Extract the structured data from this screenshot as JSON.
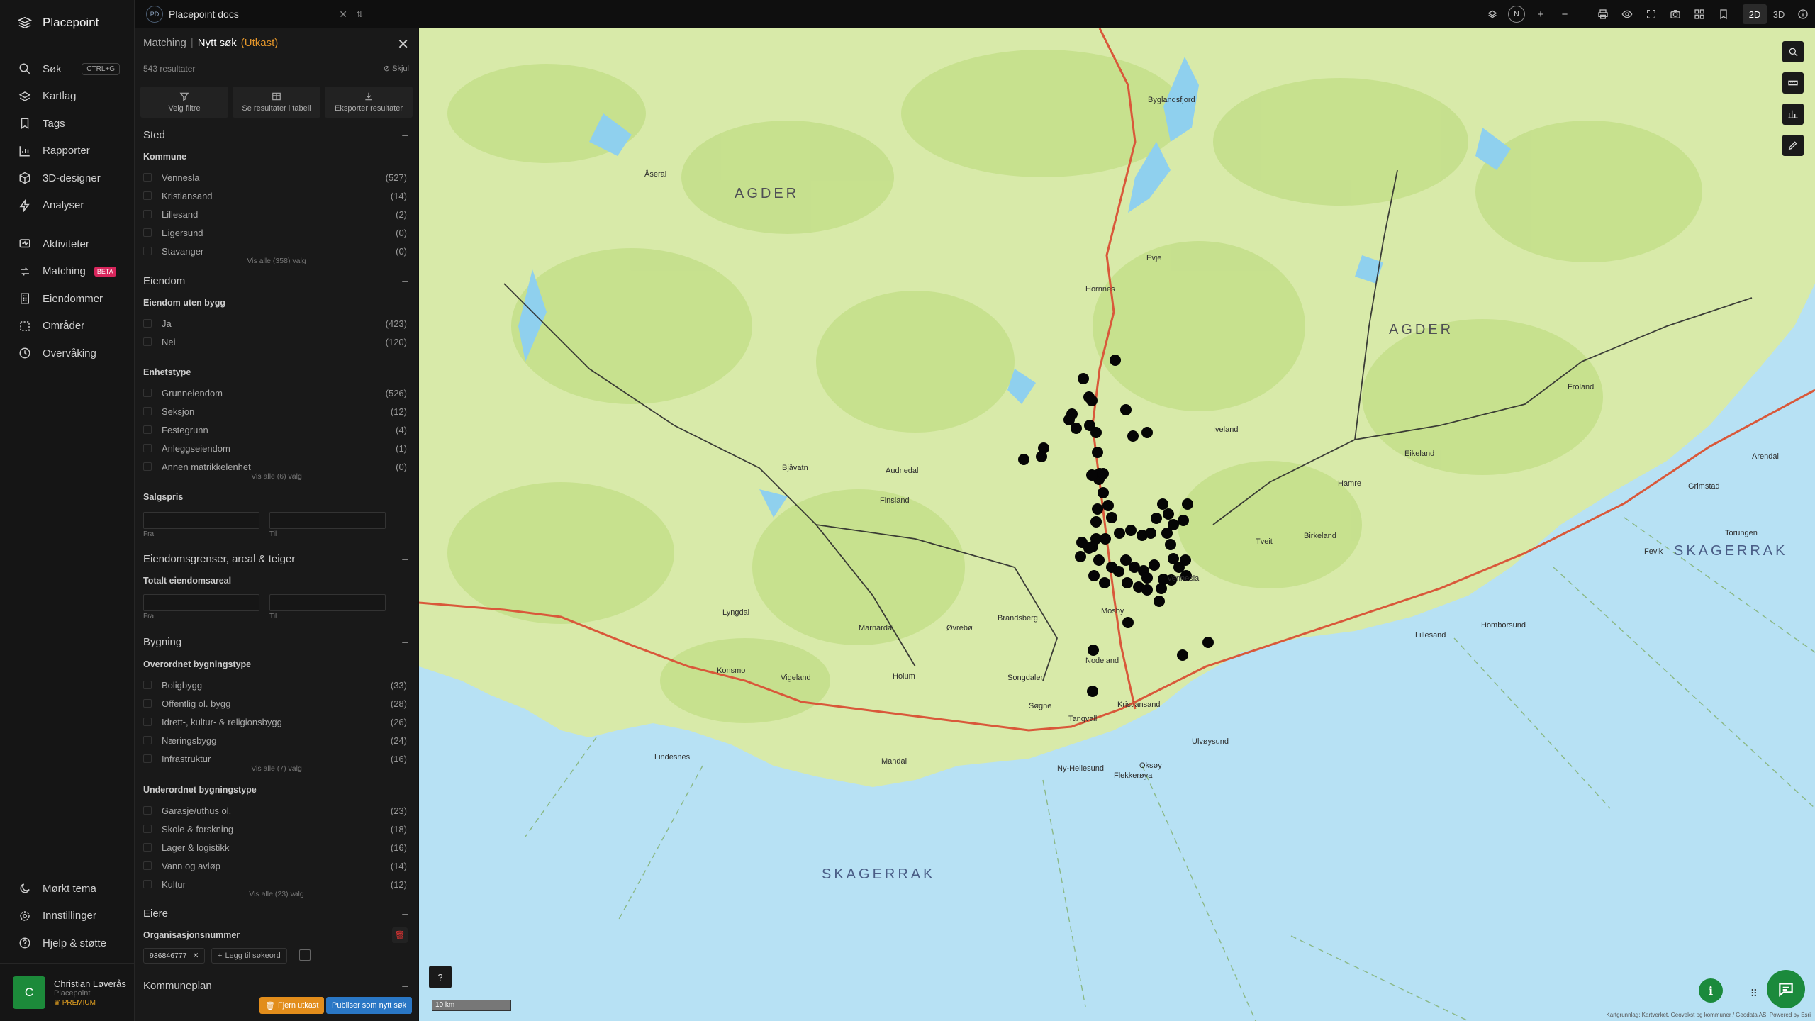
{
  "app": {
    "name": "Placepoint"
  },
  "nav": {
    "items": [
      {
        "label": "Søk",
        "icon": "search-icon",
        "kbd": "CTRL+G"
      },
      {
        "label": "Kartlag",
        "icon": "layers-icon"
      },
      {
        "label": "Tags",
        "icon": "bookmark-icon"
      },
      {
        "label": "Rapporter",
        "icon": "chart-icon"
      },
      {
        "label": "3D-designer",
        "icon": "cube-icon"
      },
      {
        "label": "Analyser",
        "icon": "bolt-icon"
      },
      {
        "label": "Aktiviteter",
        "icon": "activity-icon"
      },
      {
        "label": "Matching",
        "icon": "matching-icon",
        "badge": "BETA"
      },
      {
        "label": "Eiendommer",
        "icon": "building-icon"
      },
      {
        "label": "Områder",
        "icon": "area-icon"
      },
      {
        "label": "Overvåking",
        "icon": "monitor-icon"
      }
    ],
    "bottom": [
      {
        "label": "Mørkt tema",
        "icon": "moon-icon"
      },
      {
        "label": "Innstillinger",
        "icon": "gear-icon"
      },
      {
        "label": "Hjelp & støtte",
        "icon": "help-icon"
      }
    ],
    "user": {
      "initial": "C",
      "name": "Christian Løverås",
      "org": "Placepoint",
      "plan": "PREMIUM"
    }
  },
  "topbar": {
    "doc_badge": "PD",
    "doc_title": "Placepoint docs",
    "compass": "N",
    "view_2d": "2D",
    "view_3d": "3D",
    "active_view": "2D"
  },
  "panel": {
    "crumb": "Matching",
    "separator": "|",
    "title": "Nytt søk",
    "status": "(Utkast)",
    "results": "543 resultater",
    "hide_label": "Skjul",
    "actions": [
      "Velg filtre",
      "Se resultater i tabell",
      "Eksporter resultater"
    ],
    "sections": {
      "sted": {
        "title": "Sted",
        "kommune": {
          "label": "Kommune",
          "options": [
            {
              "label": "Vennesla",
              "count": "(527)"
            },
            {
              "label": "Kristiansand",
              "count": "(14)"
            },
            {
              "label": "Lillesand",
              "count": "(2)"
            },
            {
              "label": "Eigersund",
              "count": "(0)"
            },
            {
              "label": "Stavanger",
              "count": "(0)"
            }
          ],
          "more": "Vis alle (358) valg"
        }
      },
      "eiendom": {
        "title": "Eiendom",
        "uten_bygg": {
          "label": "Eiendom uten bygg",
          "options": [
            {
              "label": "Ja",
              "count": "(423)"
            },
            {
              "label": "Nei",
              "count": "(120)"
            }
          ]
        },
        "enhetstype": {
          "label": "Enhetstype",
          "options": [
            {
              "label": "Grunneiendom",
              "count": "(526)"
            },
            {
              "label": "Seksjon",
              "count": "(12)"
            },
            {
              "label": "Festegrunn",
              "count": "(4)"
            },
            {
              "label": "Anleggseiendom",
              "count": "(1)"
            },
            {
              "label": "Annen matrikkelenhet",
              "count": "(0)"
            }
          ],
          "more": "Vis alle (6) valg"
        },
        "salgspris": {
          "label": "Salgspris",
          "from": "Fra",
          "to": "Til"
        }
      },
      "grenser": {
        "title": "Eiendomsgrenser, areal & teiger",
        "areal": {
          "label": "Totalt eiendomsareal",
          "from": "Fra",
          "to": "Til"
        }
      },
      "bygning": {
        "title": "Bygning",
        "overordnet": {
          "label": "Overordnet bygningstype",
          "options": [
            {
              "label": "Boligbygg",
              "count": "(33)"
            },
            {
              "label": "Offentlig ol. bygg",
              "count": "(28)"
            },
            {
              "label": "Idrett-, kultur- & religionsbygg",
              "count": "(26)"
            },
            {
              "label": "Næringsbygg",
              "count": "(24)"
            },
            {
              "label": "Infrastruktur",
              "count": "(16)"
            }
          ],
          "more": "Vis alle (7) valg"
        },
        "underordnet": {
          "label": "Underordnet bygningstype",
          "options": [
            {
              "label": "Garasje/uthus ol.",
              "count": "(23)"
            },
            {
              "label": "Skole & forskning",
              "count": "(18)"
            },
            {
              "label": "Lager & logistikk",
              "count": "(16)"
            },
            {
              "label": "Vann og avløp",
              "count": "(14)"
            },
            {
              "label": "Kultur",
              "count": "(12)"
            }
          ],
          "more": "Vis alle (23) valg"
        }
      },
      "eiere": {
        "title": "Eiere",
        "org": {
          "label": "Organisasjonsnummer",
          "tag": "936846777",
          "add": "Legg til søkeord"
        }
      },
      "kommuneplan": {
        "title": "Kommuneplan"
      }
    },
    "footer": {
      "remove": "Fjern utkast",
      "publish": "Publiser som nytt søk"
    }
  },
  "map": {
    "labels": {
      "agder_1": "AGDER",
      "agder_2": "AGDER",
      "skagerrak_1": "SKAGERRAK",
      "skagerrak_2": "SKAGERRAK",
      "places": [
        "Byglandsfjord",
        "Evje",
        "Hornnes",
        "Vennesla",
        "Kristiansand",
        "Lillesand",
        "Birkeland",
        "Mosby",
        "Søgne",
        "Tangvall",
        "Nodeland",
        "Songdalen",
        "Finsland",
        "Konsmo",
        "Åseral",
        "Iveland",
        "Grimstad",
        "Arendal",
        "Froland",
        "Tveit",
        "Mandal",
        "Lindesnes",
        "Holum",
        "Marnardal",
        "Vigeland",
        "Lyngdal",
        "Audnedal",
        "Brandsberg",
        "Øvrebø",
        "Bjåvatn",
        "Eikeland",
        "Hamre",
        "Fevik",
        "Torungen",
        "Homborsund",
        "Ulvøysund",
        "Flekkerøya",
        "Ny-Hellesund",
        "Oksøy"
      ]
    },
    "scale": "10 km",
    "attribution": "Kartgrunnlag: Kartverket, Geovekst og kommuner / Geodata AS. Powered by Esri",
    "help": "?",
    "info": "i",
    "colors": {
      "land": "#d7e9a8",
      "forest": "#c4df8a",
      "water": "#b7e1f4",
      "lake": "#8fd0ee",
      "road": "#d9583a",
      "marker": "#050505"
    }
  }
}
